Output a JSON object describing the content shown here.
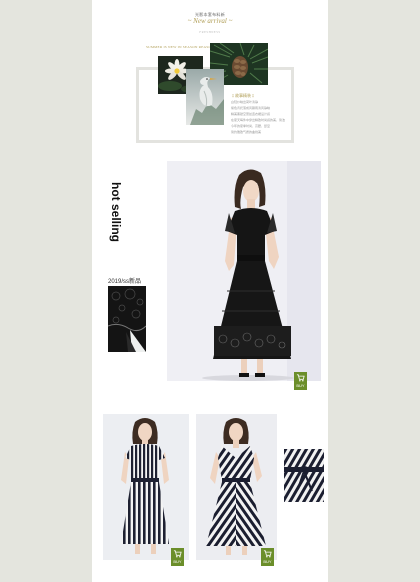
{
  "header": {
    "title_cn": "光影本套布料新",
    "title_en": "~ New arrival ~",
    "subtitle": "FRESHNESS"
  },
  "season_label": "SUMMER IS NEW IN SEASON REASON",
  "story": {
    "title": "‡ 故事精装 ‡",
    "lines": [
      "白轻纱映出荷叶清静",
      "紫色背托落成风飘雨清风静映",
      "精美黑镂空蕾丝连衣裙设计感",
      "在夏天每件中穿出精致时尚感的美，简洁",
      "今年的夏季时尚，高腰，彰显",
      "简约雅致气质的曲线美"
    ]
  },
  "hot_selling": "hot selling",
  "tag_new": "2019/ss新品",
  "buy_label": "BUY",
  "colors": {
    "accent_gold": "#b2a05a",
    "buy_green": "#6b8e2a",
    "side_band": "#e4e5de"
  },
  "icons": [
    "cart-icon"
  ]
}
